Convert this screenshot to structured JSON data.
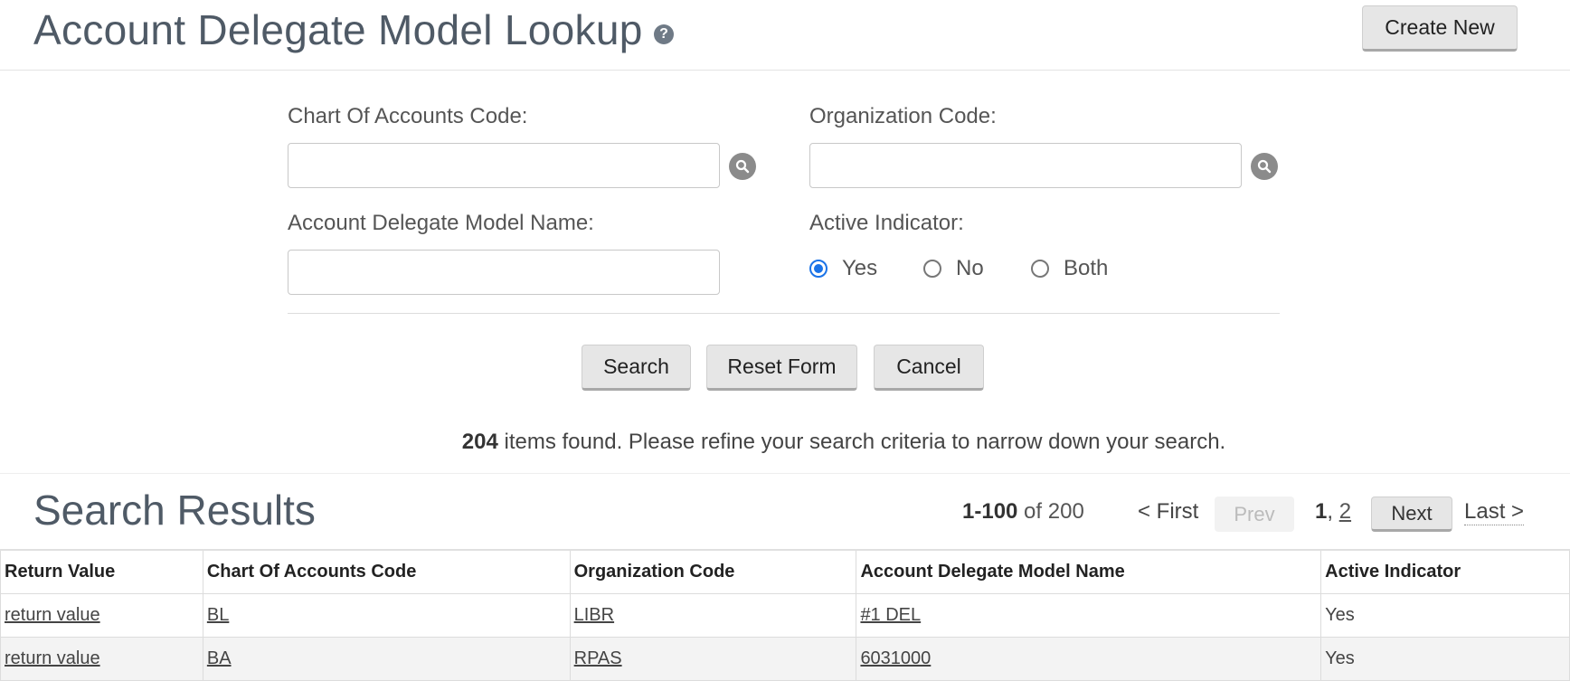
{
  "header": {
    "title": "Account Delegate Model Lookup",
    "help_symbol": "?",
    "create_new_label": "Create New"
  },
  "form": {
    "chart_of_accounts_label": "Chart Of Accounts Code:",
    "chart_of_accounts_value": "",
    "organization_label": "Organization Code:",
    "organization_value": "",
    "model_name_label": "Account Delegate Model Name:",
    "model_name_value": "",
    "active_indicator_label": "Active Indicator:",
    "active_options": [
      "Yes",
      "No",
      "Both"
    ],
    "active_selected": "Yes"
  },
  "actions": {
    "search_label": "Search",
    "reset_label": "Reset Form",
    "cancel_label": "Cancel"
  },
  "message": {
    "count": "204",
    "text": " items found. Please refine your search criteria to narrow down your search."
  },
  "results": {
    "title": "Search Results",
    "range": "1-100",
    "range_suffix": " of 200",
    "first_label": "< First",
    "prev_label": "Prev",
    "current_page": "1",
    "page_sep": ", ",
    "other_page": "2",
    "next_label": "Next",
    "last_label": "Last >",
    "columns": [
      "Return Value",
      "Chart Of Accounts Code",
      "Organization Code",
      "Account Delegate Model Name",
      "Active Indicator"
    ],
    "rows": [
      {
        "return_value": "return value",
        "chart": "BL",
        "org": "LIBR",
        "name": "#1 DEL",
        "active": "Yes"
      },
      {
        "return_value": "return value",
        "chart": "BA",
        "org": "RPAS",
        "name": "6031000",
        "active": "Yes"
      }
    ]
  }
}
